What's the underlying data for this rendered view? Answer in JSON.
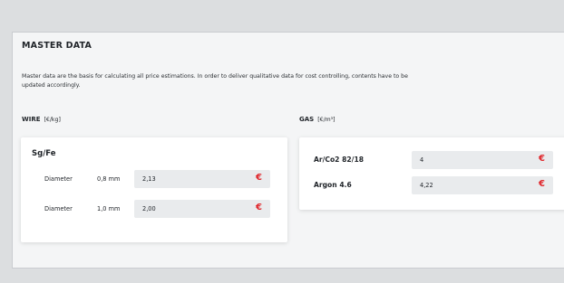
{
  "page": {
    "title": "MASTER DATA",
    "description": "Master data are the basis for calculating all price estimations. In order to deliver qualitative data for cost controlling, contents have to be updated accordingly."
  },
  "wire": {
    "label": "WIRE",
    "unit": "[€/kg]",
    "card_title": "Sg/Fe",
    "rows": [
      {
        "label": "Diameter",
        "size": "0,8 mm",
        "value": "2,13",
        "currency": "€"
      },
      {
        "label": "Diameter",
        "size": "1,0 mm",
        "value": "2,00",
        "currency": "€"
      }
    ]
  },
  "gas": {
    "label": "GAS",
    "unit": "[€/m³]",
    "rows": [
      {
        "name": "Ar/Co2 82/18",
        "value": "4",
        "currency": "€"
      },
      {
        "name": "Argon 4.6",
        "value": "4,22",
        "currency": "€"
      }
    ]
  },
  "colors": {
    "currency": "#e0262b",
    "page_bg": "#dcdee0",
    "panel_bg": "#f4f5f6",
    "field_bg": "#e9ebed"
  }
}
